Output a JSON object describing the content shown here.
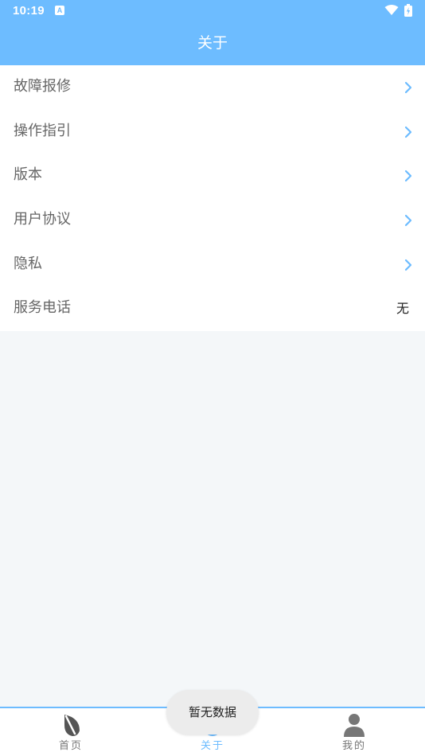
{
  "status_bar": {
    "time": "10:19",
    "notification_icon_letter": "A"
  },
  "header": {
    "title": "关于"
  },
  "menu": {
    "items": [
      {
        "label": "故障报修",
        "has_chevron": true
      },
      {
        "label": "操作指引",
        "has_chevron": true
      },
      {
        "label": "版本",
        "has_chevron": true
      },
      {
        "label": "用户协议",
        "has_chevron": true
      },
      {
        "label": "隐私",
        "has_chevron": true
      },
      {
        "label": "服务电话",
        "value": "无"
      }
    ]
  },
  "tabbar": {
    "tabs": [
      {
        "label": "首页",
        "icon": "leaf-icon",
        "active": false
      },
      {
        "label": "关于",
        "icon": "info-icon",
        "active": true
      },
      {
        "label": "我的",
        "icon": "person-icon",
        "active": false
      }
    ]
  },
  "toast": {
    "message": "暂无数据"
  },
  "colors": {
    "accent": "#6dbcff",
    "background": "#f4f7f9",
    "label": "#666666"
  }
}
